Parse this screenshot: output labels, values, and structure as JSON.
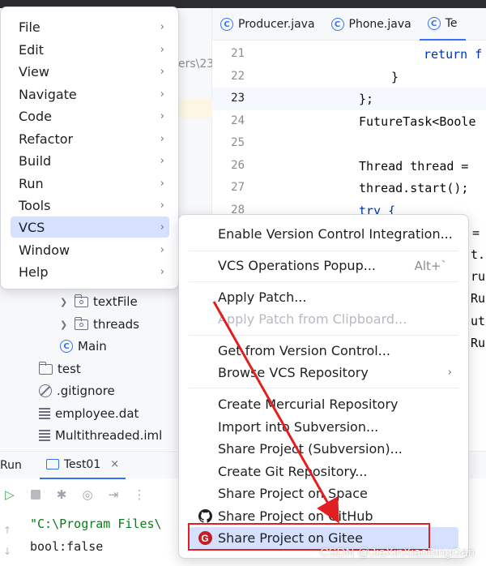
{
  "editor_tabs": [
    {
      "label": "Producer.java",
      "icon": "class-icon"
    },
    {
      "label": "Phone.java",
      "icon": "class-icon"
    },
    {
      "label": "Te",
      "icon": "class-icon"
    }
  ],
  "project": {
    "path_fragment": "ers\\23",
    "tree": [
      {
        "label": "textFile",
        "icon": "package-folder-icon"
      },
      {
        "label": "threads",
        "icon": "package-folder-icon"
      },
      {
        "label": "Main",
        "icon": "class-icon"
      },
      {
        "label": "test",
        "icon": "folder-icon"
      },
      {
        "label": ".gitignore",
        "icon": "ignore-icon"
      },
      {
        "label": "employee.dat",
        "icon": "file-lines-icon"
      },
      {
        "label": "Multithreaded.iml",
        "icon": "file-lines-icon"
      }
    ]
  },
  "editor": {
    "lines": [
      {
        "num": "21",
        "code": "return f"
      },
      {
        "num": "22",
        "code": "}"
      },
      {
        "num": "23",
        "code": "};"
      },
      {
        "num": "24",
        "code": "FutureTask<Boole"
      },
      {
        "num": "25",
        "code": ""
      },
      {
        "num": "26",
        "code": "Thread thread ="
      },
      {
        "num": "27",
        "code": "thread.start();"
      },
      {
        "num": "28",
        "code": "try {"
      }
    ],
    "right_fragments": [
      "=",
      "t.p",
      "ru",
      "Ru",
      "uti",
      "Ru"
    ],
    "class_letter": "C"
  },
  "main_menu": {
    "items": [
      "File",
      "Edit",
      "View",
      "Navigate",
      "Code",
      "Refactor",
      "Build",
      "Run",
      "Tools",
      "VCS",
      "Window",
      "Help"
    ],
    "highlighted": "VCS",
    "arrow": "›"
  },
  "vcs_submenu": {
    "items": [
      {
        "label": "Enable Version Control Integration..."
      },
      {
        "label": "VCS Operations Popup...",
        "shortcut": "Alt+`"
      },
      {
        "label": "Apply Patch..."
      },
      {
        "label": "Apply Patch from Clipboard...",
        "disabled": true
      },
      {
        "label": "Get from Version Control..."
      },
      {
        "label": "Browse VCS Repository"
      },
      {
        "label": "Create Mercurial Repository"
      },
      {
        "label": "Import into Subversion..."
      },
      {
        "label": "Share Project (Subversion)..."
      },
      {
        "label": "Create Git Repository..."
      },
      {
        "label": "Share Project on Space"
      },
      {
        "label": "Share Project on GitHub",
        "icon": "github-icon"
      },
      {
        "label": "Share Project on Gitee",
        "icon": "gitee-icon",
        "highlighted": true
      }
    ],
    "gitee_letter": "G"
  },
  "run_panel": {
    "label": "Run",
    "tab_label": "Test01",
    "close_glyph": "×",
    "console": [
      "\"C:\\Program Files\\",
      "bool:false"
    ]
  },
  "watermark": "CSDN @JiaXinXiaoBingGan",
  "colors": {
    "accent": "#3574f0",
    "highlight": "#d5e1ff",
    "annotation_red": "#e02020",
    "gitee_red": "#c71d23"
  }
}
